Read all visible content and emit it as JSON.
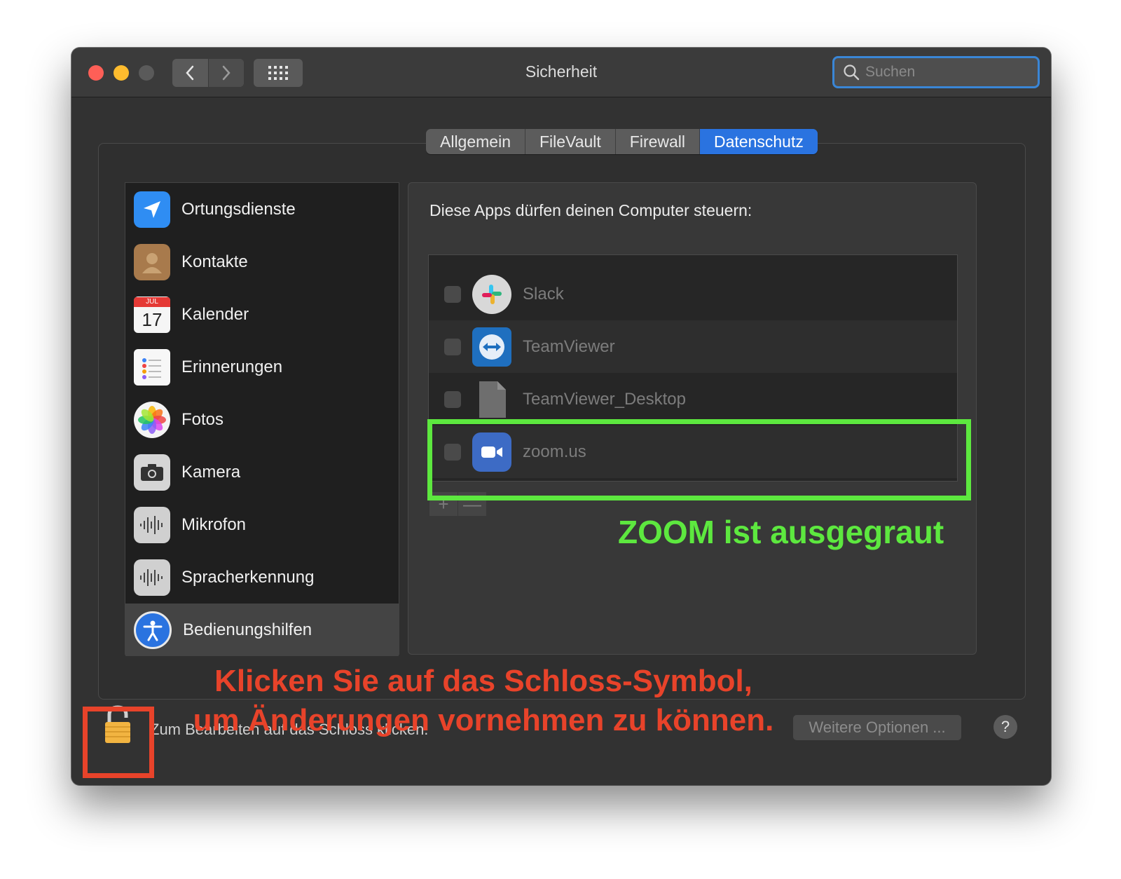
{
  "window": {
    "title": "Sicherheit",
    "search_placeholder": "Suchen"
  },
  "tabs": [
    {
      "label": "Allgemein",
      "active": false
    },
    {
      "label": "FileVault",
      "active": false
    },
    {
      "label": "Firewall",
      "active": false
    },
    {
      "label": "Datenschutz",
      "active": true
    }
  ],
  "sidebar": {
    "items": [
      {
        "label": "Ortungsdienste",
        "icon": "location-arrow-icon"
      },
      {
        "label": "Kontakte",
        "icon": "contacts-icon"
      },
      {
        "label": "Kalender",
        "icon": "calendar-icon"
      },
      {
        "label": "Erinnerungen",
        "icon": "reminders-icon"
      },
      {
        "label": "Fotos",
        "icon": "photos-icon"
      },
      {
        "label": "Kamera",
        "icon": "camera-icon"
      },
      {
        "label": "Mikrofon",
        "icon": "microphone-icon"
      },
      {
        "label": "Spracherkennung",
        "icon": "speech-recognition-icon"
      },
      {
        "label": "Bedienungshilfen",
        "icon": "accessibility-icon",
        "selected": true
      }
    ]
  },
  "calendar_icon": {
    "month": "JUL",
    "day": "17"
  },
  "panel": {
    "heading": "Diese Apps dürfen deinen Computer steuern:",
    "apps": [
      {
        "name": "Slack",
        "icon": "slack-icon",
        "checked": false
      },
      {
        "name": "TeamViewer",
        "icon": "teamviewer-icon",
        "checked": false
      },
      {
        "name": "TeamViewer_Desktop",
        "icon": "generic-file-icon",
        "checked": false
      },
      {
        "name": "zoom.us",
        "icon": "zoom-icon",
        "checked": false
      }
    ],
    "add_label": "+",
    "remove_label": "—"
  },
  "footer": {
    "lock_text": "Zum Bearbeiten auf das Schloss klicken.",
    "options_label": "Weitere Optionen ...",
    "help_label": "?"
  },
  "annotations": {
    "green_note": "ZOOM ist ausgegraut",
    "red_note_line1": "Klicken Sie auf das Schloss-Symbol,",
    "red_note_line2": "um Änderungen vornehmen zu können.",
    "green_color": "#5de83f",
    "red_color": "#e8432a"
  }
}
